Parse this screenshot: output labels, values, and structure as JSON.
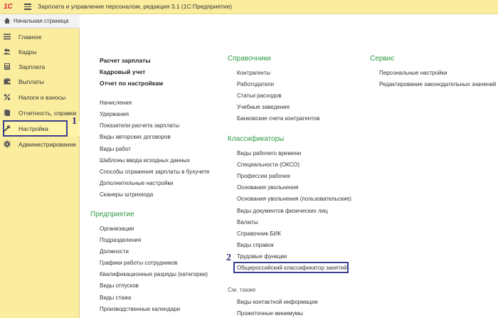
{
  "app": {
    "logo": "1С",
    "title": "Зарплата и управление персоналом, редакция 3.1  (1С:Предприятие)"
  },
  "sidebar": {
    "home": "Начальная страница",
    "items": [
      {
        "label": "Главное",
        "icon": "list-icon"
      },
      {
        "label": "Кадры",
        "icon": "people-icon"
      },
      {
        "label": "Зарплата",
        "icon": "calculator-icon"
      },
      {
        "label": "Выплаты",
        "icon": "wallet-icon"
      },
      {
        "label": "Налоги и взносы",
        "icon": "percent-icon"
      },
      {
        "label": "Отчетность, справки",
        "icon": "report-icon"
      },
      {
        "label": "Настройка",
        "icon": "wrench-icon"
      },
      {
        "label": "Администрирование",
        "icon": "gear-icon"
      }
    ]
  },
  "callouts": {
    "first": "1",
    "second": "2"
  },
  "col1": {
    "bold": [
      "Расчет зарплаты",
      "Кадровый учет",
      "Отчет по настройкам"
    ],
    "links": [
      "Начисления",
      "Удержания",
      "Показатели расчета зарплаты",
      "Виды авторских договоров",
      "Виды работ",
      "Шаблоны ввода исходных данных",
      "Способы отражения зарплаты в бухучете",
      "Дополнительные настройки",
      "Сканеры штрихкода"
    ],
    "enterprise_title": "Предприятие",
    "enterprise_links": [
      "Организации",
      "Подразделения",
      "Должности",
      "Графики работы сотрудников",
      "Квалификационные разряды (категории)",
      "Виды отпусков",
      "Виды стажа",
      "Производственные календари"
    ]
  },
  "col2": {
    "ref_title": "Справочники",
    "ref_links": [
      "Контрагенты",
      "Работодатели",
      "Статьи расходов",
      "Учебные заведения",
      "Банковские счета контрагентов"
    ],
    "class_title": "Классификаторы",
    "class_links": [
      "Виды рабочего времени",
      "Специальности (ОКСО)",
      "Профессии рабочих",
      "Основания увольнения",
      "Основания увольнения (пользовательские)",
      "Виды документов физических лиц",
      "Валюты",
      "Справочник БИК",
      "Виды справок",
      "Трудовые функции",
      "Общероссийский классификатор занятий"
    ],
    "see_title": "См. также",
    "see_links": [
      "Виды контактной информации",
      "Прожиточные минимумы"
    ]
  },
  "col3": {
    "service_title": "Сервис",
    "service_links": [
      "Персональные настройки",
      "Редактирование законодательных значений"
    ]
  }
}
